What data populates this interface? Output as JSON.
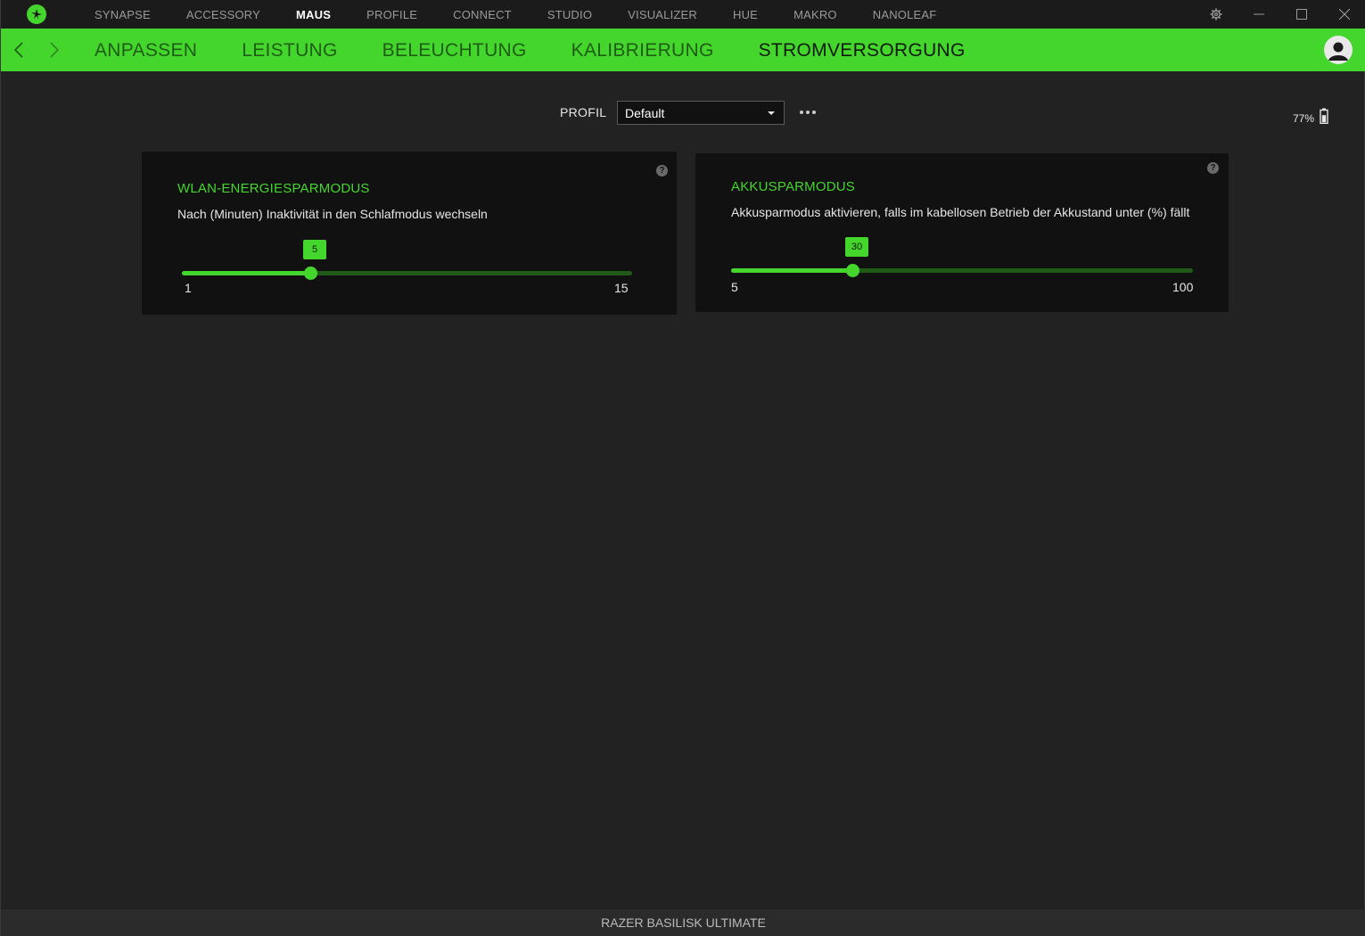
{
  "topnav": {
    "items": [
      "SYNAPSE",
      "ACCESSORY",
      "MAUS",
      "PROFILE",
      "CONNECT",
      "STUDIO",
      "VISUALIZER",
      "HUE",
      "MAKRO",
      "NANOLEAF"
    ],
    "active": "MAUS"
  },
  "subnav": {
    "tabs": [
      "ANPASSEN",
      "LEISTUNG",
      "BELEUCHTUNG",
      "KALIBRIERUNG",
      "STROMVERSORGUNG"
    ],
    "active": "STROMVERSORGUNG"
  },
  "profile": {
    "label": "PROFIL",
    "selected": "Default"
  },
  "battery": {
    "text": "77%",
    "level": 0.77
  },
  "cards": {
    "wlan": {
      "title": "WLAN-ENERGIESPARMODUS",
      "description": "Nach (Minuten) Inaktivität in den Schlafmodus wechseln",
      "value": "5",
      "min": "1",
      "max": "15",
      "help": "?"
    },
    "akku": {
      "title": "AKKUSPARMODUS",
      "description": "Akkusparmodus aktivieren, falls im kabellosen Betrieb der Akkustand unter (%) fällt",
      "value": "30",
      "min": "5",
      "max": "100",
      "help": "?"
    }
  },
  "footer": {
    "device": "RAZER BASILISK ULTIMATE"
  },
  "colors": {
    "accent": "#44d62c",
    "background": "#222222",
    "card": "#111111"
  }
}
